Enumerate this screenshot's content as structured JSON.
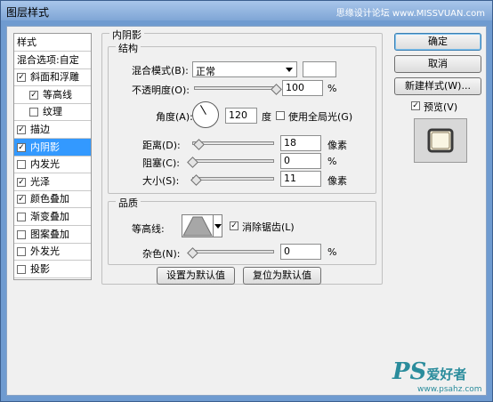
{
  "window": {
    "title": "图层样式",
    "watermark": "思缘设计论坛 www.MISSVUAN.com"
  },
  "style_list": [
    {
      "label": "样式",
      "checkbox": null,
      "indent": 0,
      "selected": false
    },
    {
      "label": "混合选项:自定",
      "checkbox": null,
      "indent": 0,
      "selected": false
    },
    {
      "label": "斜面和浮雕",
      "checkbox": "✓",
      "indent": 0,
      "selected": false
    },
    {
      "label": "等高线",
      "checkbox": "✓",
      "indent": 1,
      "selected": false
    },
    {
      "label": "纹理",
      "checkbox": "",
      "indent": 1,
      "selected": false
    },
    {
      "label": "描边",
      "checkbox": "✓",
      "indent": 0,
      "selected": false
    },
    {
      "label": "内阴影",
      "checkbox": "✓",
      "indent": 0,
      "selected": true
    },
    {
      "label": "内发光",
      "checkbox": "",
      "indent": 0,
      "selected": false
    },
    {
      "label": "光泽",
      "checkbox": "✓",
      "indent": 0,
      "selected": false
    },
    {
      "label": "颜色叠加",
      "checkbox": "✓",
      "indent": 0,
      "selected": false
    },
    {
      "label": "渐变叠加",
      "checkbox": "",
      "indent": 0,
      "selected": false
    },
    {
      "label": "图案叠加",
      "checkbox": "",
      "indent": 0,
      "selected": false
    },
    {
      "label": "外发光",
      "checkbox": "",
      "indent": 0,
      "selected": false
    },
    {
      "label": "投影",
      "checkbox": "",
      "indent": 0,
      "selected": false
    }
  ],
  "panel": {
    "section_title": "内阴影",
    "structure": {
      "title": "结构",
      "blend_mode_label": "混合模式(B):",
      "blend_mode_value": "正常",
      "opacity_label": "不透明度(O):",
      "opacity_value": "100",
      "opacity_unit": "%",
      "opacity_level": 1.0,
      "angle_label": "角度(A):",
      "angle_value": "120",
      "angle_unit": "度",
      "global_light_check": "",
      "global_light_label": "使用全局光(G)",
      "distance_label": "距离(D):",
      "distance_value": "18",
      "distance_unit": "像素",
      "distance_level": 0.072,
      "choke_label": "阻塞(C):",
      "choke_value": "0",
      "choke_unit": "%",
      "choke_level": 0.0,
      "size_label": "大小(S):",
      "size_value": "11",
      "size_unit": "像素",
      "size_level": 0.044
    },
    "quality": {
      "title": "品质",
      "contour_label": "等高线:",
      "antialias_check": "✓",
      "antialias_label": "消除锯齿(L)",
      "noise_label": "杂色(N):",
      "noise_value": "0",
      "noise_unit": "%",
      "noise_level": 0.0
    },
    "buttons": {
      "make_default": "设置为默认值",
      "reset_default": "复位为默认值"
    }
  },
  "right": {
    "ok": "确定",
    "cancel": "取消",
    "new_style": "新建样式(W)...",
    "preview_check": "✓",
    "preview_label": "预览(V)"
  },
  "logo": {
    "ps": "PS",
    "cn": "爱好者",
    "url": "www.psahz.com"
  },
  "colors": {
    "selection": "#3399ff",
    "title_bar": "#7fa6d6",
    "logo": "#2a8c9c"
  }
}
